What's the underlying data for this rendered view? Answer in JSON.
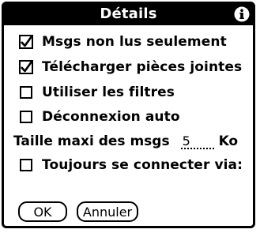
{
  "dialog": {
    "title": "Détails",
    "info_icon": "info-icon"
  },
  "options": [
    {
      "label": "Msgs non lus seulement",
      "checked": true
    },
    {
      "label": "Télécharger pièces jointes",
      "checked": true
    },
    {
      "label": "Utiliser les filtres",
      "checked": false
    },
    {
      "label": "Déconnexion auto",
      "checked": false
    }
  ],
  "max_size": {
    "label": "Taille maxi des msgs",
    "value": "5",
    "unit": "Ko"
  },
  "always_connect": {
    "label": "Toujours se connecter via:",
    "checked": false
  },
  "buttons": {
    "ok": "OK",
    "cancel": "Annuler"
  }
}
